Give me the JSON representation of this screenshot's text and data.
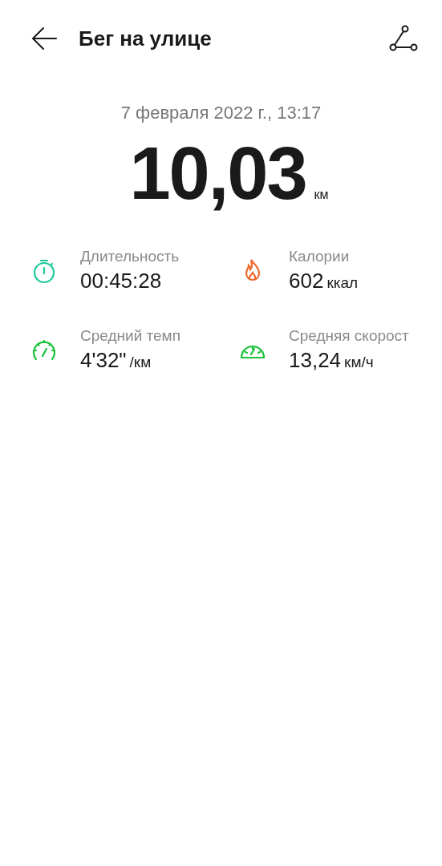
{
  "header": {
    "title": "Бег на улице"
  },
  "date": "7 февраля 2022 г., 13:17",
  "distance": {
    "value": "10,03",
    "unit": "км"
  },
  "stats": [
    {
      "kind": "stopwatch",
      "color": "#1ec99a",
      "label": "Длительность",
      "value": "00:45:28"
    },
    {
      "kind": "flame",
      "color": "#f0672a",
      "label": "Калории",
      "value": "602",
      "unit": "ккал"
    },
    {
      "kind": "pace",
      "color": "#17c23a",
      "label": "Средний темп",
      "value": "4'32\"",
      "unit": "/км"
    },
    {
      "kind": "speed",
      "color": "#17c23a",
      "label": "Средняя скорост",
      "value": "13,24",
      "unit": "км/ч"
    }
  ]
}
